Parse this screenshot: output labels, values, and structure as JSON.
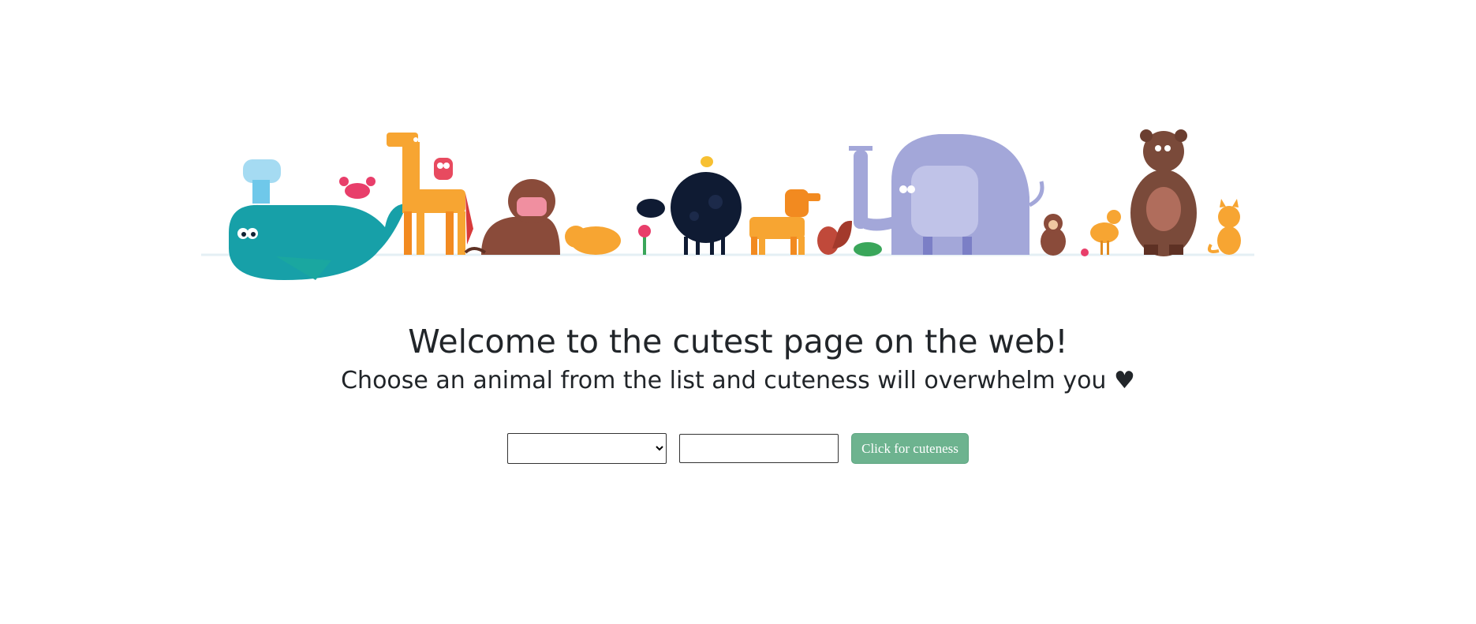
{
  "header": {
    "title": "Welcome to the cutest page on the web!",
    "subtitle": "Choose an animal from the list and cuteness will overwhelm you ♥"
  },
  "form": {
    "select_value": "",
    "text_value": "",
    "button_label": "Click for cuteness"
  },
  "colors": {
    "button": "#6db38f",
    "text": "#212529"
  }
}
